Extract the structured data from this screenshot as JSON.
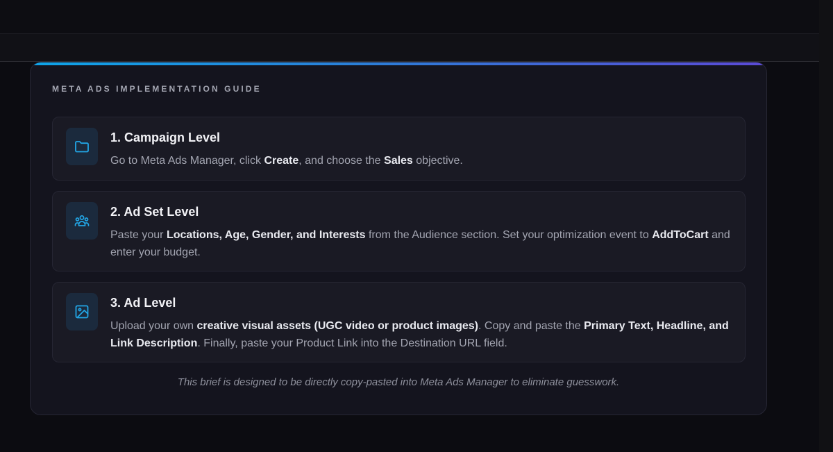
{
  "guide": {
    "heading": "META ADS IMPLEMENTATION GUIDE",
    "accent_colors": [
      "#0ea5e9",
      "#5b4ad6"
    ],
    "icon_color": "#22a6e6",
    "steps": [
      {
        "icon": "folder-icon",
        "title": "1. Campaign Level",
        "desc": {
          "t1": "Go to Meta Ads Manager, click ",
          "b1": "Create",
          "t2": ", and choose the ",
          "b2": "Sales",
          "t3": " objective."
        }
      },
      {
        "icon": "users-icon",
        "title": "2. Ad Set Level",
        "desc": {
          "t1": "Paste your ",
          "b1": "Locations, Age, Gender, and Interests",
          "t2": " from the Audience section. Set your optimization event to ",
          "b2": "AddToCart",
          "t3": " and enter your budget."
        }
      },
      {
        "icon": "image-icon",
        "title": "3. Ad Level",
        "desc": {
          "t1": "Upload your own ",
          "b1": "creative visual assets (UGC video or product images)",
          "t2": ". Copy and paste the ",
          "b2": "Primary Text, Headline, and Link Description",
          "t3": ". Finally, paste your Product Link into the Destination URL field."
        }
      }
    ],
    "footer": "This brief is designed to be directly copy-pasted into Meta Ads Manager to eliminate guesswork."
  }
}
